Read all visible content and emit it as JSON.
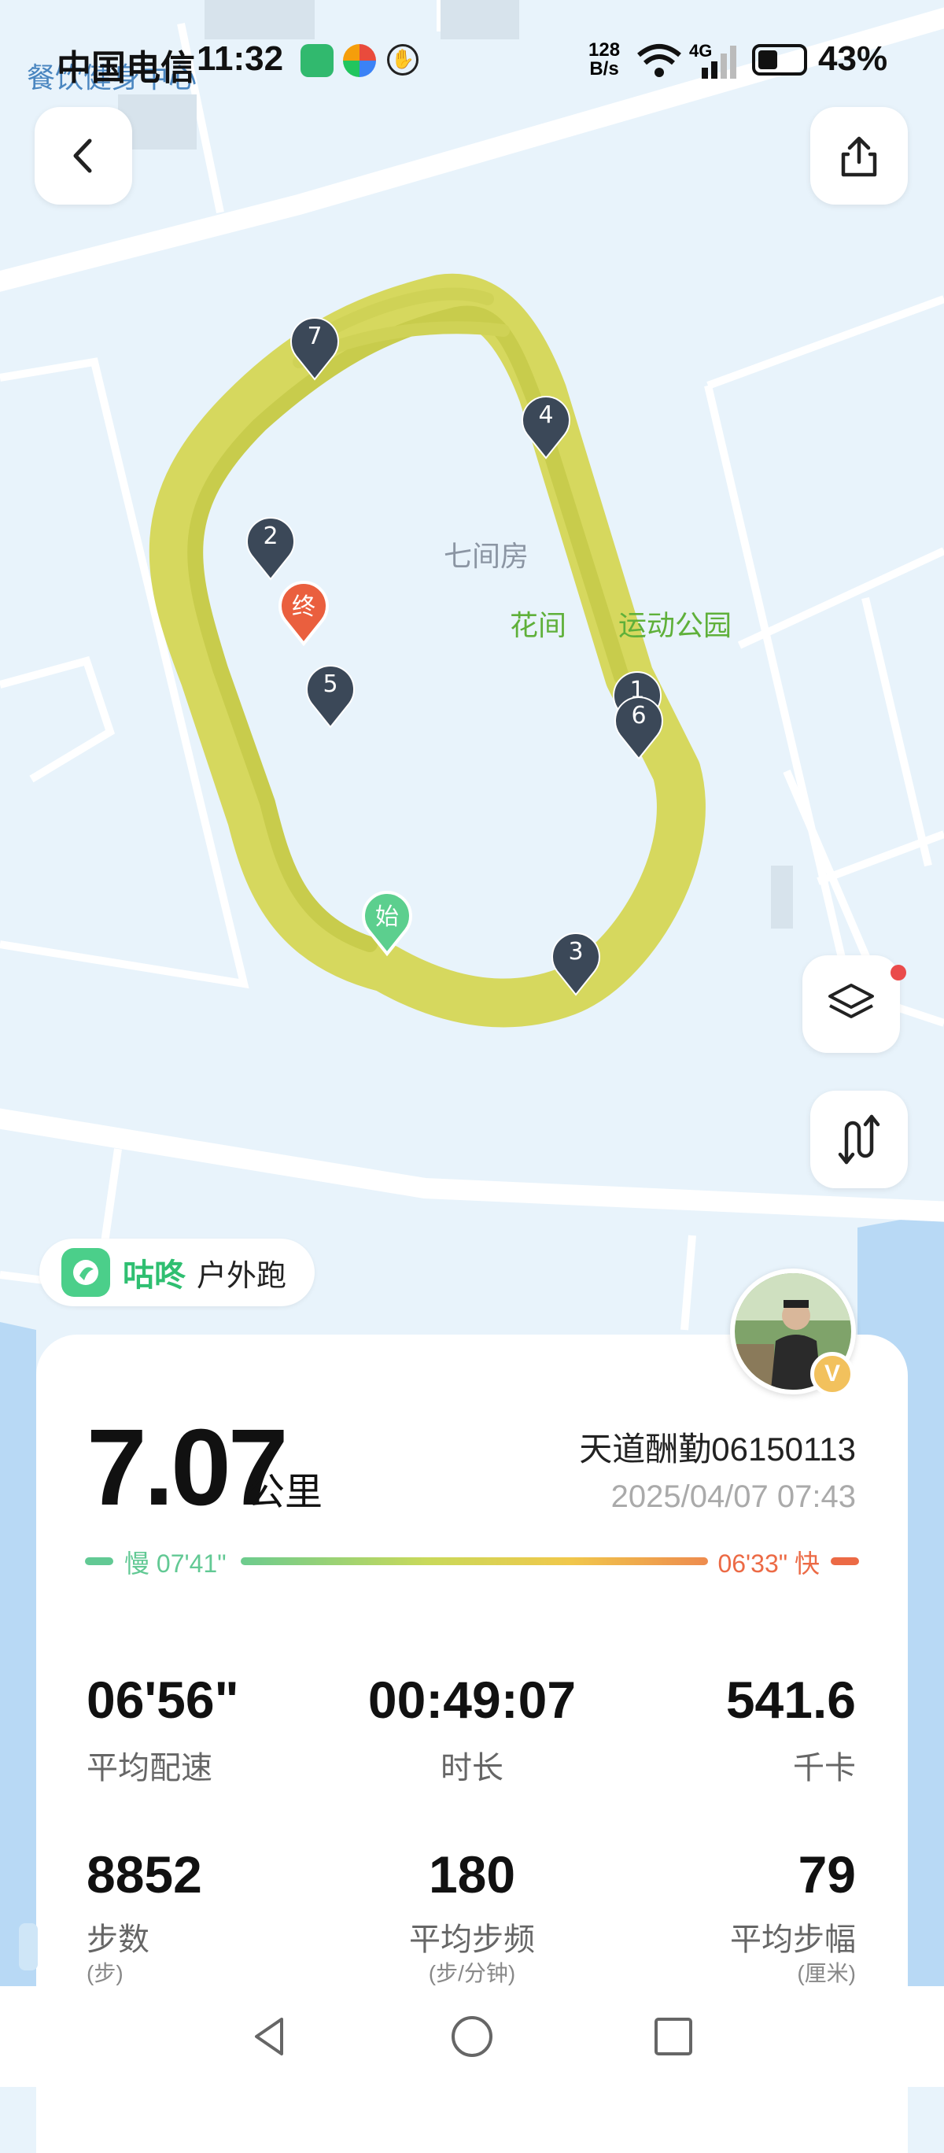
{
  "status_bar": {
    "carrier": "中国电信",
    "time": "11:32",
    "net_speed_value": "128",
    "net_speed_unit": "B/s",
    "network": "4G",
    "battery": "43%",
    "map_overlap_text": "餐饮健身中心"
  },
  "map": {
    "place_label": "七间房",
    "park_label": "花间",
    "park_label_rest": "运动公园",
    "track_color": "#d6d85e",
    "start_marker": "始",
    "end_marker": "终",
    "km_markers": [
      "1",
      "2",
      "3",
      "4",
      "5",
      "6",
      "7"
    ]
  },
  "icons": {
    "back": "back-chevron-icon",
    "share": "share-icon",
    "layers": "layers-icon",
    "route": "route-icon"
  },
  "brand": {
    "name": "咕咚",
    "activity": "户外跑",
    "color": "#2fbf71"
  },
  "summary": {
    "distance": "7.07",
    "distance_unit": "公里",
    "username": "天道酬勤06150113",
    "datetime": "2025/04/07 07:43",
    "avatar_badge": "V"
  },
  "pace_range": {
    "slow_label": "慢 07'41\"",
    "fast_label": "06'33\" 快",
    "slow_color": "#62c994",
    "fast_color": "#ec6a45"
  },
  "stats": [
    {
      "value": "06'56\"",
      "label": "平均配速",
      "unit": ""
    },
    {
      "value": "00:49:07",
      "label": "时长",
      "unit": ""
    },
    {
      "value": "541.6",
      "label": "千卡",
      "unit": ""
    },
    {
      "value": "8852",
      "label": "步数",
      "unit": "(步)"
    },
    {
      "value": "180",
      "label": "平均步频",
      "unit": "(步/分钟)"
    },
    {
      "value": "79",
      "label": "平均步幅",
      "unit": "(厘米)"
    }
  ]
}
